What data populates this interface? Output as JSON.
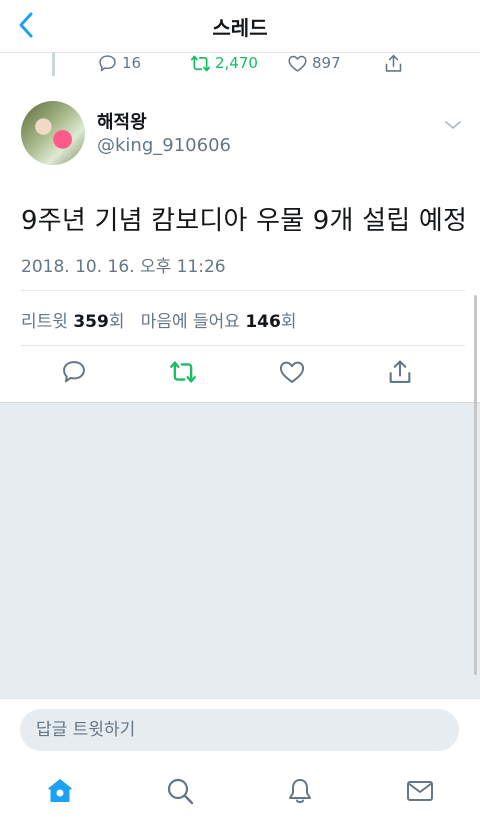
{
  "nav": {
    "title": "스레드"
  },
  "prev_tweet": {
    "replies": "16",
    "retweets": "2,470",
    "likes": "897"
  },
  "tweet": {
    "display_name": "해적왕",
    "handle": "@king_910606",
    "text": "9주년 기념 캄보디아 우물 9개 설립 예정",
    "timestamp": "2018. 10. 16. 오후 11:26"
  },
  "stats": {
    "retweet_label": "리트윗",
    "retweet_count": "359",
    "retweet_suffix": "회",
    "like_label": "마음에 들어요",
    "like_count": "146",
    "like_suffix": "회"
  },
  "reply": {
    "placeholder": "답글 트윗하기"
  },
  "tabs": [
    "home-icon",
    "search-icon",
    "bell-icon",
    "mail-icon"
  ],
  "colors": {
    "accent": "#1da1f2",
    "retweet": "#17bf63",
    "muted": "#657786"
  }
}
